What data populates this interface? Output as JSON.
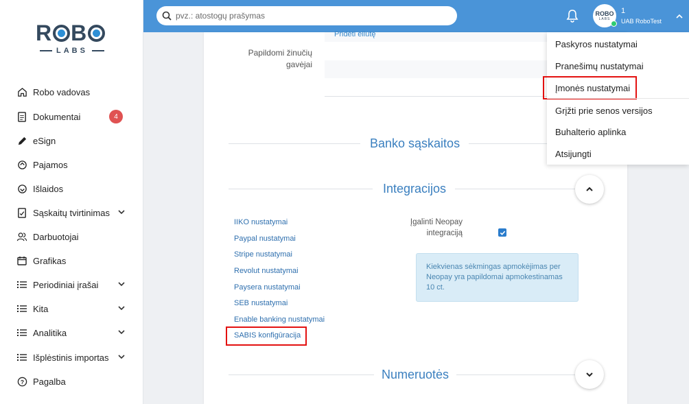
{
  "brand": {
    "logo_top": "ROBO",
    "logo_bottom": "LABS"
  },
  "search": {
    "placeholder": "pvz.: atostogų prašymas"
  },
  "user": {
    "count": "1",
    "company": "UAB RoboTest",
    "avatar_text": "ROBO",
    "avatar_sub": "LABS"
  },
  "sidebar": {
    "items": [
      {
        "label": "Robo vadovas",
        "icon": "home-icon"
      },
      {
        "label": "Dokumentai",
        "icon": "document-icon",
        "badge": "4"
      },
      {
        "label": "eSign",
        "icon": "pen-icon"
      },
      {
        "label": "Pajamos",
        "icon": "income-icon"
      },
      {
        "label": "Išlaidos",
        "icon": "expense-icon"
      },
      {
        "label": "Sąskaitų tvirtinimas",
        "icon": "approve-doc-icon",
        "expandable": true
      },
      {
        "label": "Darbuotojai",
        "icon": "users-icon"
      },
      {
        "label": "Grafikas",
        "icon": "calendar-icon"
      },
      {
        "label": "Periodiniai įrašai",
        "icon": "list-icon",
        "expandable": true
      },
      {
        "label": "Kita",
        "icon": "list-icon",
        "expandable": true
      },
      {
        "label": "Analitika",
        "icon": "list-icon",
        "expandable": true
      },
      {
        "label": "Išplėstinis importas",
        "icon": "list-icon",
        "expandable": true
      },
      {
        "label": "Pagalba",
        "icon": "help-icon"
      }
    ]
  },
  "main": {
    "add_row": "Pridėti eilutę",
    "extra_recipients_label": "Papildomi žinučių gavėjai",
    "sections": {
      "bank": "Banko sąskaitos",
      "integrations": "Integracijos",
      "numbering": "Numeruotės"
    },
    "integration_links": [
      "IIKO nustatymai",
      "Paypal nustatymai",
      "Stripe nustatymai",
      "Revolut nustatymai",
      "Paysera nustatymai",
      "SEB nustatymai",
      "Enable banking nustatymai",
      "SABIS konfigūracija"
    ],
    "neopay": {
      "label": "Įgalinti Neopay integraciją",
      "checked": true,
      "info": "Kiekvienas sėkmingas apmokėjimas per Neopay yra papildomai apmokestinamas 10 ct."
    }
  },
  "dropdown": {
    "items": [
      "Paskyros nustatymai",
      "Pranešimų nustatymai",
      "Įmonės nustatymai",
      "Grįžti prie senos versijos",
      "Buhalterio aplinka",
      "Atsijungti"
    ]
  },
  "colors": {
    "topbar": "#4a94d8",
    "accent_title": "#3a7fbf",
    "highlight": "#e3100f",
    "badge": "#e05252"
  }
}
